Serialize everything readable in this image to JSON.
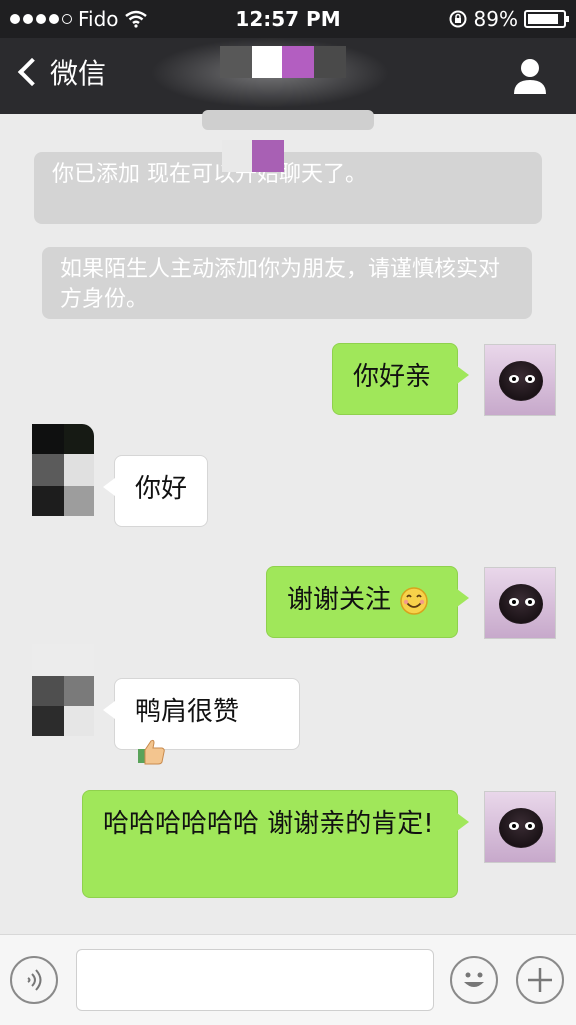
{
  "status_bar": {
    "carrier": "Fido",
    "time": "12:57 PM",
    "battery": "89%",
    "battery_level": 0.89,
    "signal_bars": 4
  },
  "nav": {
    "back_label": "微信",
    "title_obscured": true
  },
  "system_messages": [
    {
      "text": "你已添加                       现在可以开始聊天了。"
    },
    {
      "text": "如果陌生人主动添加你为朋友，请谨慎核实对方身份。"
    }
  ],
  "messages": [
    {
      "direction": "out",
      "text": "你好亲"
    },
    {
      "direction": "in",
      "text": "你好"
    },
    {
      "direction": "out",
      "text": "谢谢关注",
      "emoji": "smile-emoji"
    },
    {
      "direction": "in",
      "text": "鸭肩很赞",
      "emoji": "thumbs-up-emoji"
    },
    {
      "direction": "out",
      "text": "哈哈哈哈哈哈 谢谢亲的肯定!"
    }
  ],
  "input_bar": {
    "voice_icon": "voice-icon",
    "emoji_icon": "emoji-face-icon",
    "plus_icon": "plus-icon"
  },
  "colors": {
    "outgoing_bubble": "#a0e75a",
    "incoming_bubble": "#ffffff",
    "nav_background": "#2b2b2e",
    "chat_background": "#ebebeb"
  }
}
